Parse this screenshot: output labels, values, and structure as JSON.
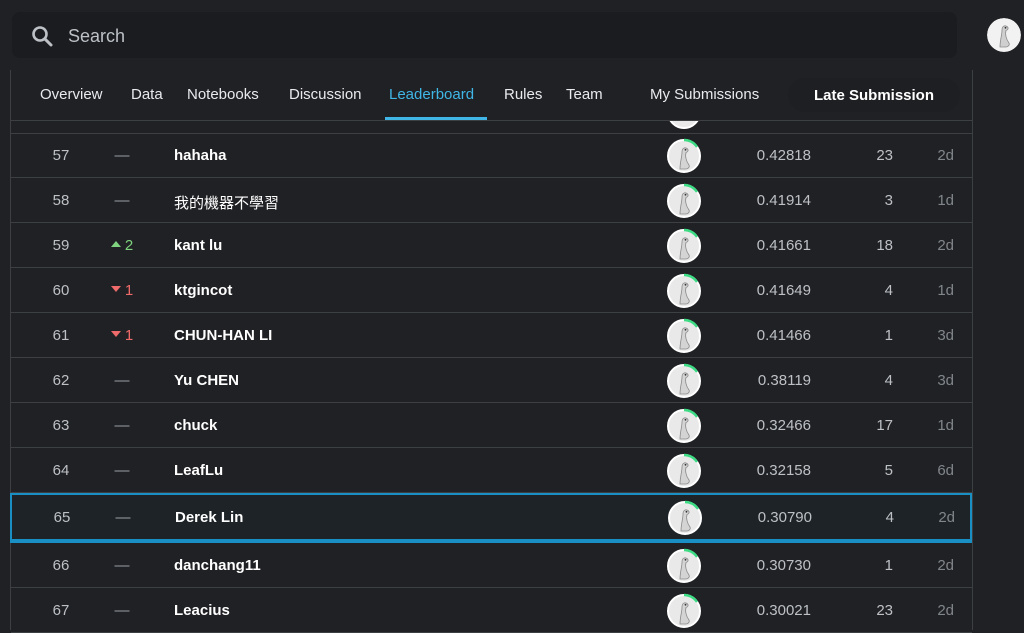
{
  "search": {
    "placeholder": "Search"
  },
  "tabs": [
    {
      "label": "Overview",
      "active": false
    },
    {
      "label": "Data",
      "active": false
    },
    {
      "label": "Notebooks",
      "active": false
    },
    {
      "label": "Discussion",
      "active": false
    },
    {
      "label": "Leaderboard",
      "active": true
    },
    {
      "label": "Rules",
      "active": false
    },
    {
      "label": "Team",
      "active": false
    },
    {
      "label": "My Submissions",
      "active": false
    }
  ],
  "late_submission_label": "Late Submission",
  "colors": {
    "accent": "#3fb6e6",
    "up": "#7fd47f",
    "down": "#ef6a6a",
    "avatar_ring": "#3ddc84"
  },
  "leaderboard": {
    "rows": [
      {
        "rank": "57",
        "delta": "—",
        "delta_dir": "none",
        "team": "hahaha",
        "score": "0.42818",
        "entries": "23",
        "last": "2d",
        "highlight": false
      },
      {
        "rank": "58",
        "delta": "—",
        "delta_dir": "none",
        "team": "我的機器不學習",
        "score": "0.41914",
        "entries": "3",
        "last": "1d",
        "highlight": false
      },
      {
        "rank": "59",
        "delta": "2",
        "delta_dir": "up",
        "team": "kant lu",
        "score": "0.41661",
        "entries": "18",
        "last": "2d",
        "highlight": false
      },
      {
        "rank": "60",
        "delta": "1",
        "delta_dir": "down",
        "team": "ktgincot",
        "score": "0.41649",
        "entries": "4",
        "last": "1d",
        "highlight": false
      },
      {
        "rank": "61",
        "delta": "1",
        "delta_dir": "down",
        "team": "CHUN-HAN LI",
        "score": "0.41466",
        "entries": "1",
        "last": "3d",
        "highlight": false
      },
      {
        "rank": "62",
        "delta": "—",
        "delta_dir": "none",
        "team": "Yu CHEN",
        "score": "0.38119",
        "entries": "4",
        "last": "3d",
        "highlight": false
      },
      {
        "rank": "63",
        "delta": "—",
        "delta_dir": "none",
        "team": "chuck",
        "score": "0.32466",
        "entries": "17",
        "last": "1d",
        "highlight": false
      },
      {
        "rank": "64",
        "delta": "—",
        "delta_dir": "none",
        "team": "LeafLu",
        "score": "0.32158",
        "entries": "5",
        "last": "6d",
        "highlight": false
      },
      {
        "rank": "65",
        "delta": "—",
        "delta_dir": "none",
        "team": "Derek Lin",
        "score": "0.30790",
        "entries": "4",
        "last": "2d",
        "highlight": true
      },
      {
        "rank": "66",
        "delta": "—",
        "delta_dir": "none",
        "team": "danchang11",
        "score": "0.30730",
        "entries": "1",
        "last": "2d",
        "highlight": false
      },
      {
        "rank": "67",
        "delta": "—",
        "delta_dir": "none",
        "team": "Leacius",
        "score": "0.30021",
        "entries": "23",
        "last": "2d",
        "highlight": false
      }
    ]
  }
}
